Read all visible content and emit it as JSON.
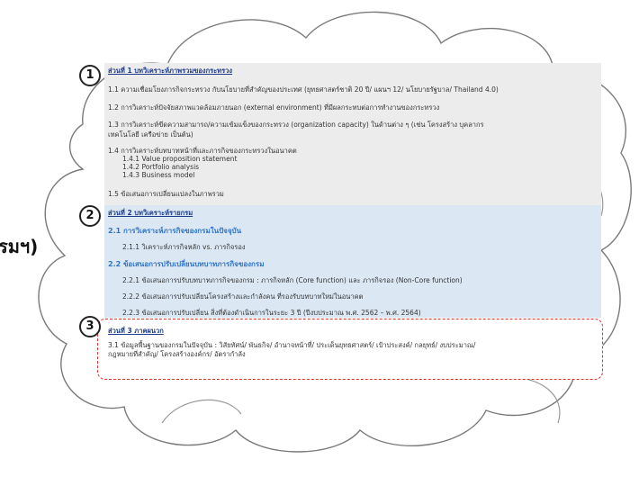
{
  "fragment": "รมฯ)",
  "markers": [
    "1",
    "2",
    "3"
  ],
  "part1": {
    "header": "ส่วนที่ 1 บทวิเคราะห์ภาพรวมของกระทรวง",
    "items": [
      "1.1  ความเชื่อมโยงภารกิจกระทรวง กับนโยบายที่สำคัญของประเทศ (ยุทธศาสตร์ชาติ 20 ปี/ แผนฯ 12/ นโยบายรัฐบาล/ Thailand 4.0)",
      "1.2  การวิเคราะห์ปัจจัยสภาพแวดล้อมภายนอก (external environment) ที่มีผลกระทบต่อการทำงานของกระทรวง",
      "1.3  การวิเคราะห์ขีดความสามารถ/ความเข้มแข็งของกระทรวง (organization capacity) ในด้านต่าง ๆ (เช่น โครงสร้าง บุคลากร",
      "       เทคโนโลยี เครือข่าย เป็นต้น)",
      "1.4  การวิเคราะห์บทบาทหน้าที่และภารกิจของกระทรวงในอนาคต",
      "1.4.1 Value proposition statement",
      "1.4.2 Portfolio analysis",
      "1.4.3 Business model",
      "1.5  ข้อเสนอการเปลี่ยนแปลงในภาพรวม"
    ]
  },
  "part2": {
    "header": "ส่วนที่ 2 บทวิเคราะห์รายกรม",
    "sub1": "2.1  การวิเคราะห์ภารกิจของกรมในปัจจุบัน",
    "sub1_items": [
      "2.1.1  วิเคราะห์ภารกิจหลัก vs. ภารกิจรอง"
    ],
    "sub2": "2.2  ข้อเสนอการปรับเปลี่ยนบทบาทภารกิจของกรม",
    "sub2_items": [
      "2.2.1  ข้อเสนอการปรับบทบาทภารกิจของกรม : ภารกิจหลัก (Core function) และ ภารกิจรอง (Non-Core function)",
      "2.2.2  ข้อเสนอการปรับเปลี่ยนโครงสร้างและกำลังคน ที่รองรับบทบาทใหม่ในอนาคต",
      "2.2.3  ข้อเสนอการปรับเปลี่ยน สิ่งที่ต้องดำเนินการในระยะ 3 ปี (ปีงบประมาณ พ.ศ. 2562 – พ.ศ. 2564)"
    ]
  },
  "part3": {
    "header": "ส่วนที่ 3 ภาคผนวก",
    "items": [
      "3.1  ข้อมูลพื้นฐานของกรมในปัจจุบัน : วิสัยทัศน์/ พันธกิจ/ อำนาจหน้าที่/ ประเด็นยุทธศาสตร์/ เป้าประสงค์/ กลยุทธ์/ งบประมาณ/",
      "       กฎหมายที่สำคัญ/ โครงสร้างองค์กร/ อัตรากำลัง"
    ]
  }
}
